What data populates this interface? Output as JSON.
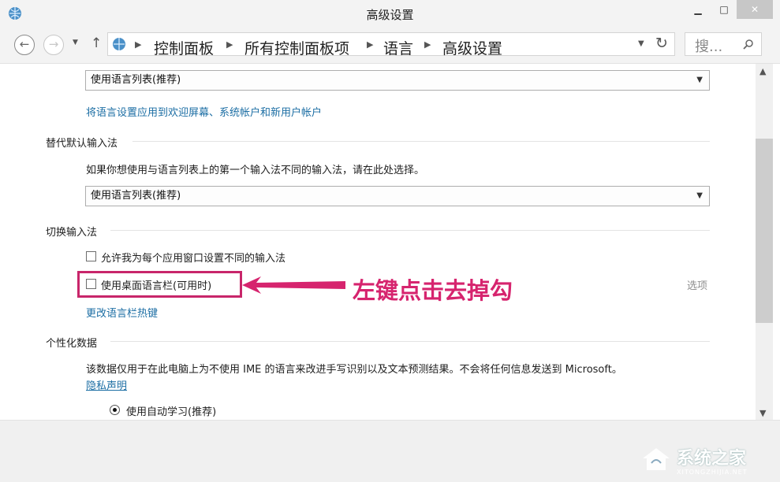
{
  "window": {
    "title": "高级设置",
    "minimize_icon": "minimize-icon",
    "maximize_icon": "maximize-icon",
    "close_icon": "close-icon"
  },
  "nav": {
    "breadcrumb": [
      "控制面板",
      "所有控制面板项",
      "语言",
      "高级设置"
    ],
    "search_placeholder": "搜...",
    "icons": [
      "back-arrow-icon",
      "forward-arrow-icon",
      "chevron-down-icon",
      "up-arrow-icon",
      "refresh-icon",
      "search-icon"
    ]
  },
  "content": {
    "display_language_select": "使用语言列表(推荐)",
    "apply_welcome_link": "将语言设置应用到欢迎屏幕、系统帐户和新用户帐户",
    "override_input": {
      "heading": "替代默认输入法",
      "description": "如果你想使用与语言列表上的第一个输入法不同的输入法，请在此处选择。",
      "select_value": "使用语言列表(推荐)"
    },
    "switch_input": {
      "heading": "切换输入法",
      "per_app_checkbox": "允许我为每个应用窗口设置不同的输入法",
      "desktop_bar_checkbox": "使用桌面语言栏(可用时)",
      "options_label": "选项",
      "hotkeys_link": "更改语言栏热键"
    },
    "personalization": {
      "heading": "个性化数据",
      "description": "该数据仅用于在此电脑上为不使用 IME 的语言来改进手写识别以及文本预测结果。不会将任何信息发送到 Microsoft。",
      "privacy_link": "隐私声明",
      "auto_learning_radio": "使用自动学习(推荐)"
    }
  },
  "annotation": {
    "callout_text": "左键点击去掉勾",
    "color": "#d6246e"
  },
  "watermark": {
    "brand": "系统之家",
    "url": "XITONGZHIJIA.NET"
  }
}
